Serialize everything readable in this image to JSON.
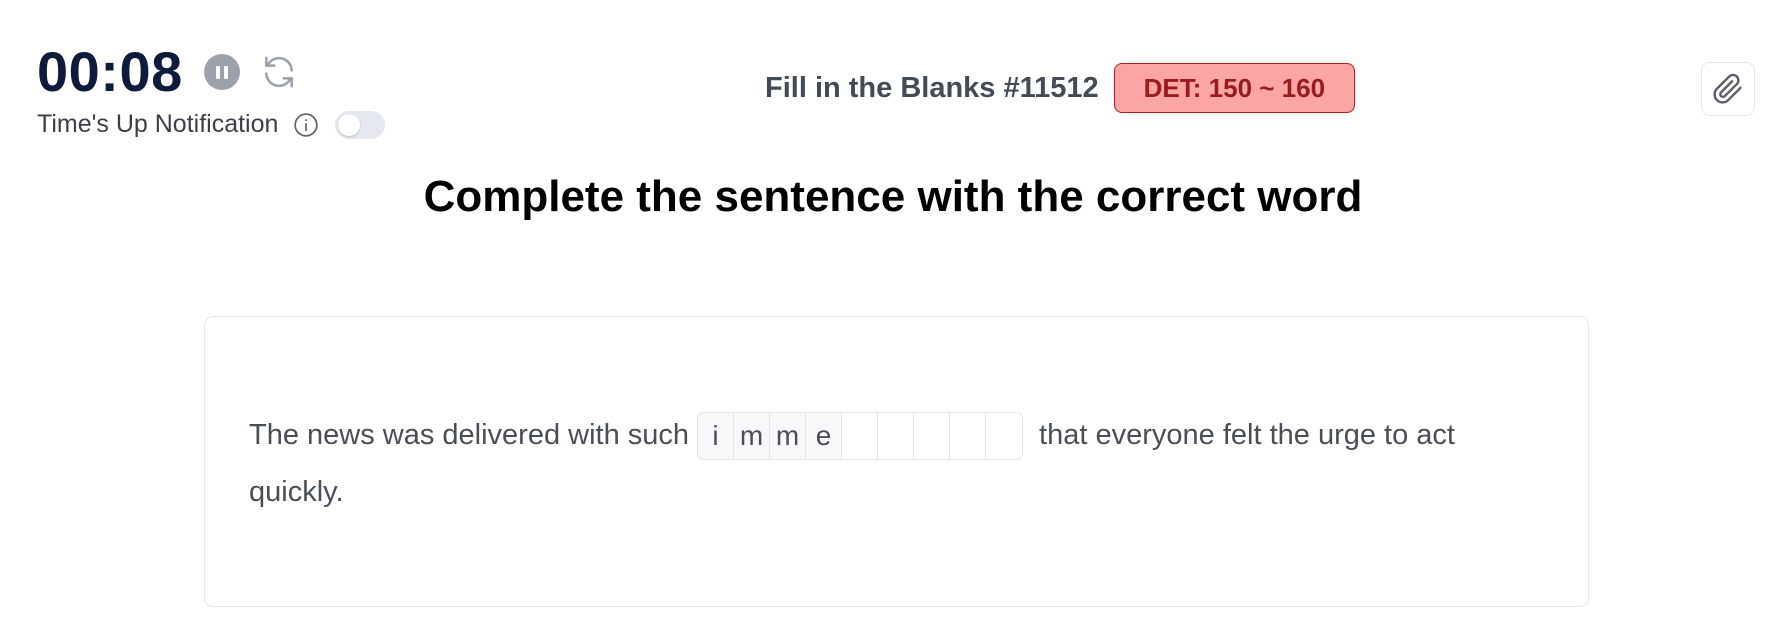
{
  "timer": {
    "time": "00:08",
    "notification_label": "Time's Up Notification",
    "notification_enabled": false
  },
  "header": {
    "exam_title": "Fill in the Blanks #11512",
    "det_badge": "DET: 150 ~ 160"
  },
  "instruction": "Complete the sentence with the correct word",
  "question": {
    "before_text": "The news was delivered with such",
    "after_text_line1": "that everyone felt the urge to act",
    "after_text_line2": "quickly.",
    "blank_letters": [
      "i",
      "m",
      "m",
      "e",
      "",
      "",
      "",
      "",
      ""
    ]
  },
  "icons": {
    "pause": "pause-icon",
    "reset": "refresh-icon",
    "info": "info-icon",
    "attach": "paperclip-icon"
  },
  "colors": {
    "timer_text": "#0f1b3d",
    "badge_bg": "#fca5a5",
    "badge_border": "#b91c1c",
    "badge_text": "#991b1b"
  }
}
